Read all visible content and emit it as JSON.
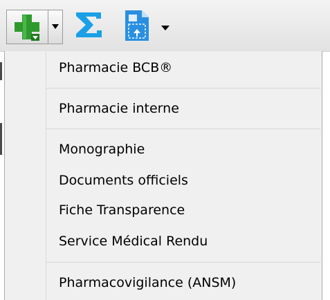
{
  "toolbar": {
    "buttons": [
      {
        "name": "add-pharmacy",
        "icon": "green-plus-icon"
      },
      {
        "name": "add-pharmacy-dropdown",
        "icon": "chevron-down-icon"
      },
      {
        "name": "sum",
        "icon": "sigma-icon"
      },
      {
        "name": "document",
        "icon": "document-icon"
      },
      {
        "name": "document-dropdown",
        "icon": "chevron-down-icon"
      }
    ],
    "colors": {
      "plus_green": "#2e9a2e",
      "sigma_blue": "#1aa0e6",
      "doc_blue": "#2a8fe0"
    }
  },
  "menu": {
    "items": [
      "Pharmacie BCB®",
      "Pharmacie interne",
      "Monographie",
      "Documents officiels",
      "Fiche Transparence",
      "Service Médical Rendu",
      "Pharmacovigilance (ANSM)"
    ]
  }
}
